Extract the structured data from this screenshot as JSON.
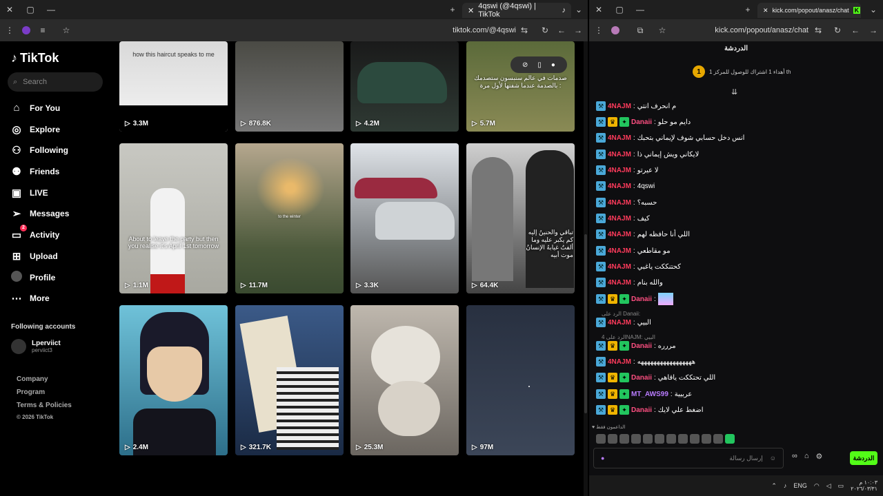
{
  "browser_left": {
    "tab_title": "4qswi (@4qswi) | TikTok",
    "url": "tiktok.com/@4qswi"
  },
  "browser_right": {
    "tab_title": "kick.com/popout/anasz/chat",
    "url": "kick.com/popout/anasz/chat"
  },
  "tiktok": {
    "brand": "TikTok",
    "search_placeholder": "Search",
    "nav": [
      {
        "label": "For You",
        "icon": "home-icon"
      },
      {
        "label": "Explore",
        "icon": "compass-icon"
      },
      {
        "label": "Following",
        "icon": "following-icon"
      },
      {
        "label": "Friends",
        "icon": "friends-icon"
      },
      {
        "label": "LIVE",
        "icon": "live-icon"
      },
      {
        "label": "Messages",
        "icon": "messages-icon"
      },
      {
        "label": "Activity",
        "icon": "activity-icon",
        "badge": "2"
      },
      {
        "label": "Upload",
        "icon": "upload-icon"
      },
      {
        "label": "Profile",
        "icon": "avatar"
      },
      {
        "label": "More",
        "icon": "more-icon"
      }
    ],
    "following_title": "Following accounts",
    "account": {
      "name": "Lperviict",
      "handle": "perviict3"
    },
    "footer": [
      "Company",
      "Program",
      "Terms & Policies",
      "© 2026 TikTok"
    ],
    "videos": [
      {
        "views": "3.3M",
        "caption": "how this haircut speaks to me"
      },
      {
        "views": "876.8K",
        "caption": ""
      },
      {
        "views": "4.2M",
        "caption": ""
      },
      {
        "views": "5.7M",
        "caption": "صدمات في عالم سنبسون ستصدمك بالصدمة عندما شفتها لأول مرة :"
      },
      {
        "views": "1.1M",
        "caption": "About to leave the party but then you realise it's April 1st tomorrow"
      },
      {
        "views": "11.7M",
        "caption": "to the winter"
      },
      {
        "views": "3.3K",
        "caption": ""
      },
      {
        "views": "64.4K",
        "caption": "تباقي والحنينُ إليه كم يكبر عليه وما ألفتُ غيابهُ الإنسانُ موت أبيه"
      },
      {
        "views": "2.4M",
        "caption": ""
      },
      {
        "views": "321.7K",
        "caption": ""
      },
      {
        "views": "25.3M",
        "caption": ""
      },
      {
        "views": "97M",
        "caption": ""
      }
    ]
  },
  "kick": {
    "header": "الدردشة",
    "banner_count": "1",
    "banner_text": "أهداء 1 اشتراك للوصول للمركز 1 th",
    "messages": [
      {
        "user": "4NAJM",
        "badges": [
          "blue"
        ],
        "text": "م انحرف انتي"
      },
      {
        "user": "Danaii",
        "badges": [
          "blue",
          "gold",
          "green"
        ],
        "text": "دايم مو حلو"
      },
      {
        "user": "4NAJM",
        "badges": [
          "blue"
        ],
        "text": "انس دخل حسابي شوف لإيماني بتحبك"
      },
      {
        "user": "4NAJM",
        "badges": [
          "blue"
        ],
        "text": "لايكاني ويش إيماني ذا"
      },
      {
        "user": "4NAJM",
        "badges": [
          "blue"
        ],
        "text": "لا عيرتو"
      },
      {
        "user": "4NAJM",
        "badges": [
          "blue"
        ],
        "text": "4qswi"
      },
      {
        "user": "4NAJM",
        "badges": [
          "blue"
        ],
        "text": "حسبه؟"
      },
      {
        "user": "4NAJM",
        "badges": [
          "blue"
        ],
        "text": "كيف"
      },
      {
        "user": "4NAJM",
        "badges": [
          "blue"
        ],
        "text": "اللي أنا حافظه لهم"
      },
      {
        "user": "4NAJM",
        "badges": [
          "blue"
        ],
        "text": "مو مقاطعي"
      },
      {
        "user": "4NAJM",
        "badges": [
          "blue"
        ],
        "text": "كحتنككت ياغبي"
      },
      {
        "user": "4NAJM",
        "badges": [
          "blue"
        ],
        "text": "والله بنام"
      },
      {
        "user": "Danaii",
        "badges": [
          "blue",
          "gold",
          "green"
        ],
        "text": ""
      },
      {
        "user": "4NAJM",
        "badges": [
          "blue"
        ],
        "text": "البيي"
      },
      {
        "user": "Danaii",
        "badges": [
          "blue",
          "gold",
          "green"
        ],
        "text": "مررره"
      },
      {
        "user": "4NAJM",
        "badges": [
          "blue"
        ],
        "text": "هههههههههههههههههه"
      },
      {
        "user": "Danaii",
        "badges": [
          "blue",
          "gold",
          "green"
        ],
        "text": "اللي تحتككت ياقاهي"
      },
      {
        "user": "MT_AWS99",
        "badges": [
          "blue",
          "gold",
          "green"
        ],
        "text": "عربيية"
      },
      {
        "user": "Danaii",
        "badges": [
          "blue",
          "gold",
          "green"
        ],
        "text": "اضغط علي لايك"
      }
    ],
    "reply1": "الرد على Danaii:",
    "reply2": "الرد على 4NAJM: البيي",
    "supporters_label": "الداعمون فقط",
    "input_placeholder": "إرسال رسالة",
    "send_label": "الدردشة"
  },
  "taskbar": {
    "lang": "ENG",
    "time": "١٠:٠٣ م",
    "date": "٢٠٢٦/٠٣/٣١"
  }
}
